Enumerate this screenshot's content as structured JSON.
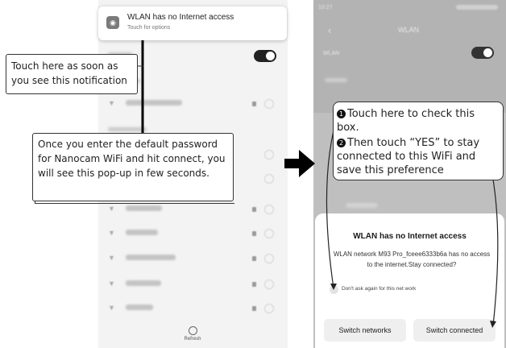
{
  "notification": {
    "title": "WLAN has no Internet access",
    "subtitle": "Touch for options",
    "icon": "globe-icon"
  },
  "left_phone": {
    "refresh_label": "Refresh"
  },
  "callouts": {
    "notification_tip": "Touch here as soon as you see this notification",
    "popup_tip": "Once you enter the default password for Nanocam WiFi and hit connect, you will see this pop-up in few seconds.",
    "checkbox_tip_1": "Touch here to check this box.",
    "checkbox_tip_2": "Then touch “YES” to stay connected to this WiFi and save this preference"
  },
  "right_phone": {
    "header_title": "WLAN",
    "wlan_label": "WLAN"
  },
  "dialog": {
    "title": "WLAN has no Internet access",
    "body": "WLAN network M93 Pro_fceee6333b6a has no access to the internet.Stay connected?",
    "checkbox_label": "Don't ask again for this net work",
    "switch_networks_label": "Switch networks",
    "switch_connected_label": "Switch connected"
  },
  "colors": {
    "accent": "#222222",
    "dialog_bg": "#ffffff",
    "backdrop": "#bfbfbf"
  }
}
